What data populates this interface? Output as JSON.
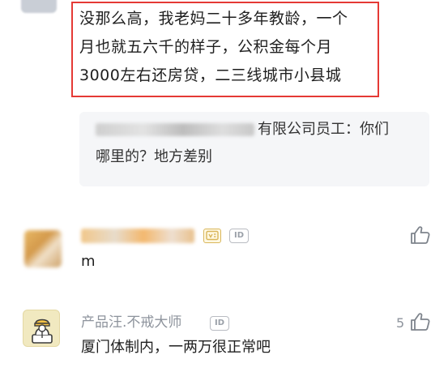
{
  "highlighted_comment": {
    "lines": [
      "没那么高，我老妈二十多年教龄，一个",
      "月也就五六千的样子，公积金每个月",
      "3000左右还房贷，二三线城市小县城"
    ]
  },
  "reply": {
    "author_suffix": "有限公司员工：",
    "text_line1": "你们",
    "text_line2": "哪里的？地方差别"
  },
  "comments": [
    {
      "username": "",
      "badge": "id",
      "text": "m",
      "like_count": ""
    },
    {
      "username": "产品汪.不戒大师",
      "badge": "id",
      "text": "厦门体制内，一两万很正常吧",
      "like_count": "5"
    }
  ],
  "labels": {
    "id_badge": "ID"
  },
  "icons": {
    "like": "thumbs-up-icon",
    "vip": "vip-card-icon",
    "avatar2": "worker-avatar-icon"
  },
  "colors": {
    "highlight_border": "#e53935",
    "reply_bg": "#f5f6f8",
    "meta_gray": "#8d939c"
  }
}
